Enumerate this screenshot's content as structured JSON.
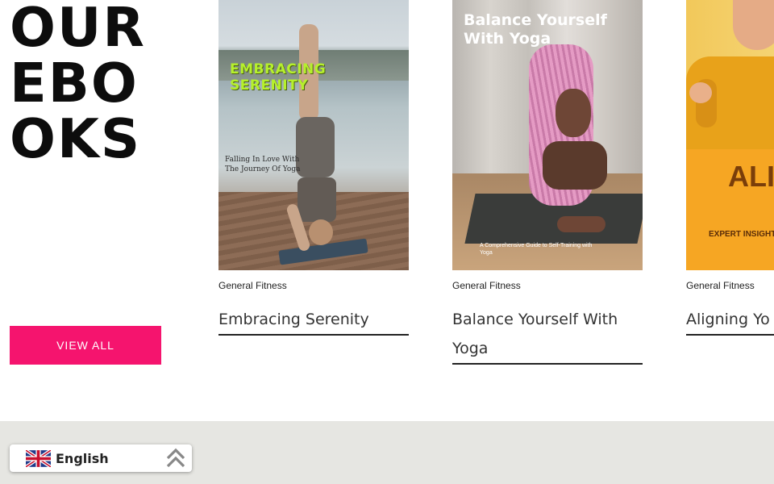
{
  "section": {
    "heading_lines": [
      "OUR",
      "EBO",
      "OKS"
    ],
    "view_all_label": "VIEW ALL"
  },
  "books": [
    {
      "category": "General Fitness",
      "title": "Embracing Serenity",
      "cover_title": "EMBRACING SERENITY",
      "cover_subtitle": "Falling In Love With The Journey Of Yoga"
    },
    {
      "category": "General Fitness",
      "title": "Balance Yourself With Yoga",
      "cover_title": "Balance Yourself With Yoga",
      "cover_subtitle": "A Comprehensive Guide to Self-Training with Yoga"
    },
    {
      "category": "General Fitness",
      "title": "Aligning Yo",
      "cover_title": "ALIG YOUR",
      "cover_subtitle": "EXPERT INSIGHTS"
    }
  ],
  "language_switcher": {
    "label": "English",
    "flag_icon": "uk-flag-icon",
    "toggle_icon": "double-chevron-up-icon"
  },
  "colors": {
    "accent": "#f5146e",
    "footer_bg": "#e6e6e2"
  }
}
